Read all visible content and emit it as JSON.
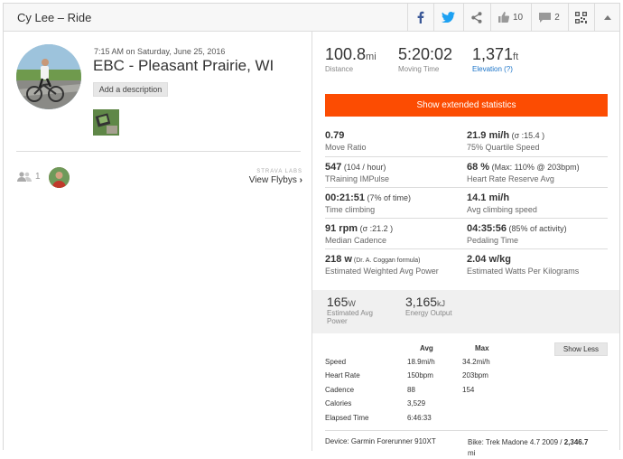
{
  "header": {
    "title": "Cy Lee – Ride",
    "kudos_count": "10",
    "comments_count": "2"
  },
  "activity": {
    "datetime": "7:15 AM on Saturday, June 25, 2016",
    "title": "EBC - Pleasant Prairie, WI",
    "description_button": "Add a description",
    "kudo_count": "1",
    "labs_label": "STRAVA LABS",
    "flyby_label": "View Flybys"
  },
  "top_stats": [
    {
      "value": "100.8",
      "unit": "mi",
      "label": "Distance"
    },
    {
      "value": "5:20:02",
      "unit": "",
      "label": "Moving Time"
    },
    {
      "value": "1,371",
      "unit": "ft",
      "label": "Elevation (?)"
    }
  ],
  "extended_button": "Show extended statistics",
  "extended": [
    [
      {
        "value": "0.79",
        "extra": "",
        "label": "Move Ratio"
      },
      {
        "value": "21.9 mi/h",
        "extra": " (σ :15.4 )",
        "label": "75% Quartile Speed"
      }
    ],
    [
      {
        "value": "547",
        "extra": " (104 / hour)",
        "label": "TRaining IMPulse"
      },
      {
        "value": "68 %",
        "extra": " (Max: 110% @ 203bpm)",
        "label": "Heart Rate Reserve Avg"
      }
    ],
    [
      {
        "value": "00:21:51",
        "extra": " (7% of time)",
        "label": "Time climbing"
      },
      {
        "value": "14.1 mi/h",
        "extra": "",
        "label": "Avg climbing speed"
      }
    ],
    [
      {
        "value": "91 rpm",
        "extra": " (σ :21.2 )",
        "label": "Median Cadence"
      },
      {
        "value": "04:35:56",
        "extra": " (85% of activity)",
        "label": "Pedaling Time"
      }
    ],
    [
      {
        "value": "218 w",
        "extra": " (Dr. A. Coggan formula)",
        "label": "Estimated Weighted Avg Power"
      },
      {
        "value": "2.04 w/kg",
        "extra": "",
        "label": "Estimated Watts Per Kilograms"
      }
    ]
  ],
  "power": [
    {
      "value": "165",
      "unit": "W",
      "label": "Estimated Avg Power"
    },
    {
      "value": "3,165",
      "unit": "kJ",
      "label": "Energy Output"
    }
  ],
  "table": {
    "headers": [
      "Avg",
      "Max"
    ],
    "show_less": "Show Less",
    "rows": [
      {
        "name": "Speed",
        "avg": "18.9mi/h",
        "max": "34.2mi/h"
      },
      {
        "name": "Heart Rate",
        "avg": "150bpm",
        "max": "203bpm"
      },
      {
        "name": "Cadence",
        "avg": "88",
        "max": "154"
      },
      {
        "name": "Calories",
        "avg": "3,529",
        "max": ""
      },
      {
        "name": "Elapsed Time",
        "avg": "6:46:33",
        "max": ""
      }
    ]
  },
  "footer": {
    "device": "Device: Garmin Forerunner 910XT",
    "bike_prefix": "Bike: Trek Madone 4.7 2009 / ",
    "bike_distance": "2,346.7",
    "bike_unit": "mi"
  },
  "colors": {
    "accent": "#fc4c02",
    "facebook": "#3b5998",
    "twitter": "#1da1f2",
    "link": "#1a73c8"
  }
}
